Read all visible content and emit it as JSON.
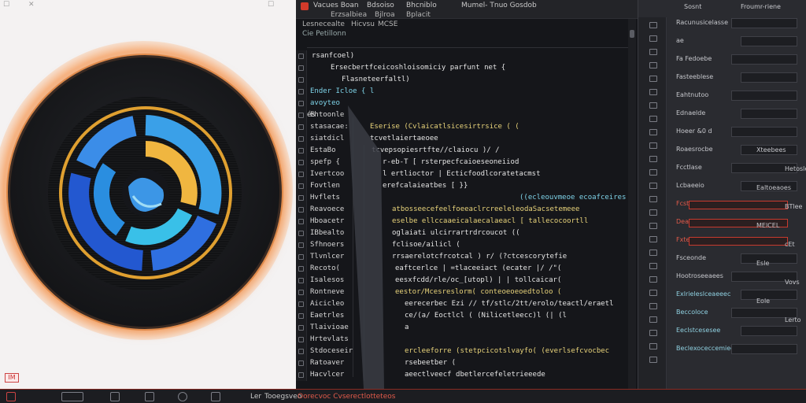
{
  "preview": {
    "top_glyphs": [
      "☐",
      "✕",
      "☐"
    ],
    "badge_label": "IM"
  },
  "menubar": {
    "items": [
      "Vacues Boan",
      "Bdsoiso",
      "Bhcniblo",
      "Mumel- Tnuo Gosdob"
    ],
    "row2": [
      "Erzsalbiea",
      "Bjlroa",
      "Bplacit"
    ],
    "row3": [
      "Lesnecealte",
      "Hicvsu",
      "MCSE",
      "Cie Petillonn"
    ]
  },
  "editor": {
    "lines": [
      {
        "num": "",
        "code": "rsanfcoel)",
        "color": "white",
        "indent": 6
      },
      {
        "num": "",
        "code": "Ersecbertfceicoshloisomiciy parfunt net  {",
        "color": "white",
        "indent": 30
      },
      {
        "num": "",
        "code": "Flasneteerfaltl)",
        "color": "white",
        "indent": 44
      },
      {
        "num": "Ender Icloe  {  l",
        "code": "",
        "color": "cyan",
        "indent": 0
      },
      {
        "num": "avoyteo",
        "code": "",
        "color": "cyan",
        "indent": 0
      },
      {
        "num": "Ehtoonle",
        "code": "és",
        "color": "white",
        "indent": 0
      },
      {
        "num": "stasacae:",
        "code": "Eserise  (Cvlaicatlsicesirtrsice  (  (",
        "color": "yellow",
        "indent": 80
      },
      {
        "num": "siatdicl",
        "code": "tcvetlaiertaeoee",
        "color": "white",
        "indent": 80
      },
      {
        "num": "EstaBo",
        "code": "tcvepsopiesrtfte//claiocu  )/  /",
        "color": "white",
        "indent": 82
      },
      {
        "num": "spefp  {",
        "code": "r-eb-T            [  rsterpecfcaioeseoneiiod",
        "color": "white",
        "indent": 96
      },
      {
        "num": "Ivertcoo",
        "code": "l  ertlioctor      |   Ecticfoodlcoratetacmst",
        "color": "white",
        "indent": 96
      },
      {
        "num": "Fovtlen",
        "code": "erefcalaieatbes  [   }}",
        "color": "white",
        "indent": 96
      },
      {
        "num": "Hvflets",
        "code": "((ecleouvmeoe ecoafceiresceer",
        "color": "cyan",
        "indent": 270
      },
      {
        "num": "Reavoece",
        "code": "atbosseecefeelfoeeaclrcreeleleodaSacsetemeee",
        "color": "yellow",
        "indent": 108
      },
      {
        "num": "Hboacetr",
        "code": "eselbe  ellccaaeicalaecalaeacl  [  tallecocoortll",
        "color": "yellow",
        "indent": 108
      },
      {
        "num": "IBbealto",
        "code": "oglaiati  ulcirrartrdrcoucot  ((",
        "color": "white",
        "indent": 108
      },
      {
        "num": "Sfhnoers",
        "code": "fclisoe/ailicl  (",
        "color": "white",
        "indent": 108
      },
      {
        "num": "Tlvnlcer",
        "code": "rrsaerelotcfrcotcal    )   r/ (?ctcescorytefie",
        "color": "white",
        "indent": 108
      },
      {
        "num": "Recoto(",
        "code": "eaftcerlce  |   =tlaceeiact   (ecater  |/ /\"(",
        "color": "white",
        "indent": 112
      },
      {
        "num": "Isalesos",
        "code": "eesxfcdd/rle/oc_[utopl)  |   |  tollcaicar(",
        "color": "white",
        "indent": 112
      },
      {
        "num": "Rontneve",
        "code": "eestor/Mcesreslorm(  conteoeoeoedtoloo  (",
        "color": "yellow",
        "indent": 112
      },
      {
        "num": "Aicicleo",
        "code": "eerecerbec  Ezi  //  tf/stlc/2tt/erolo/teactl/eraetl",
        "color": "white",
        "indent": 124
      },
      {
        "num": "Eaetrles",
        "code": "ce/(a/  Eoctlcl  (  (Nilicetleecc)l  (|  (l",
        "color": "white",
        "indent": 124
      },
      {
        "num": "Tlaivioae",
        "code": "a",
        "color": "white",
        "indent": 124
      },
      {
        "num": "Hrtevlats",
        "code": "",
        "color": "white",
        "indent": 0
      },
      {
        "num": "Stdoceseir",
        "code": "ercleeforre  (stetpcicotslvayfo(  (everlsefcvocbec",
        "color": "yellow",
        "indent": 124
      },
      {
        "num": "Ratoaver",
        "code": "rsebeetber  (",
        "color": "white",
        "indent": 124
      },
      {
        "num": "Hacvlcer",
        "code": "aeectlveecf  dbetlercefeletrieeede",
        "color": "white",
        "indent": 124
      }
    ]
  },
  "inspector": {
    "top": [
      "Sosnt",
      "Froumr-riene"
    ],
    "fields": [
      {
        "label": "Racunusicelasse",
        "style": "gray"
      },
      {
        "label": "ae",
        "style": "gray"
      },
      {
        "label": "Fa  Fedoebe",
        "style": "gray"
      },
      {
        "label": "Fasteeblese",
        "style": "gray"
      },
      {
        "label": "Eahtnutoo",
        "style": "gray"
      },
      {
        "label": "Ednaelde",
        "style": "gray"
      },
      {
        "label": "Hoeer  &0  d",
        "style": "gray"
      },
      {
        "label": "Roaesrocbe",
        "style": "gray"
      },
      {
        "label": "Fcctlase",
        "style": "gray"
      },
      {
        "label": "Lcbaeeio",
        "style": "gray"
      },
      {
        "label": "Fcstoocloecattfccooeeveoto",
        "style": "red"
      },
      {
        "label": "Deascereaecer",
        "style": "red"
      },
      {
        "label": "Fxteloss",
        "style": "red"
      },
      {
        "label": "Fsceonde",
        "style": "gray"
      },
      {
        "label": "Hootroseeaees",
        "style": "gray"
      },
      {
        "label": "Exlrieleslceaeeec",
        "style": "cyan"
      },
      {
        "label": "Beccoloce",
        "style": "cyan"
      },
      {
        "label": "Eeclstcesesee",
        "style": "cyan"
      },
      {
        "label": "Beclexoceccemiee",
        "style": "cyan"
      }
    ],
    "right_values": [
      "Xteebees",
      "Hetosles",
      "Ealtoeaoes",
      "BTlee",
      "MElCEL",
      "cEt",
      "Esle",
      "Vovs",
      "Eole",
      "Lerto"
    ]
  },
  "status": {
    "texts": [
      "Ler",
      "Tooegsveo",
      "Oorecvoc  Cvserectlotteteos"
    ],
    "colors": {
      "accent": "#d23a2a",
      "text": "#c9c9c9"
    }
  }
}
